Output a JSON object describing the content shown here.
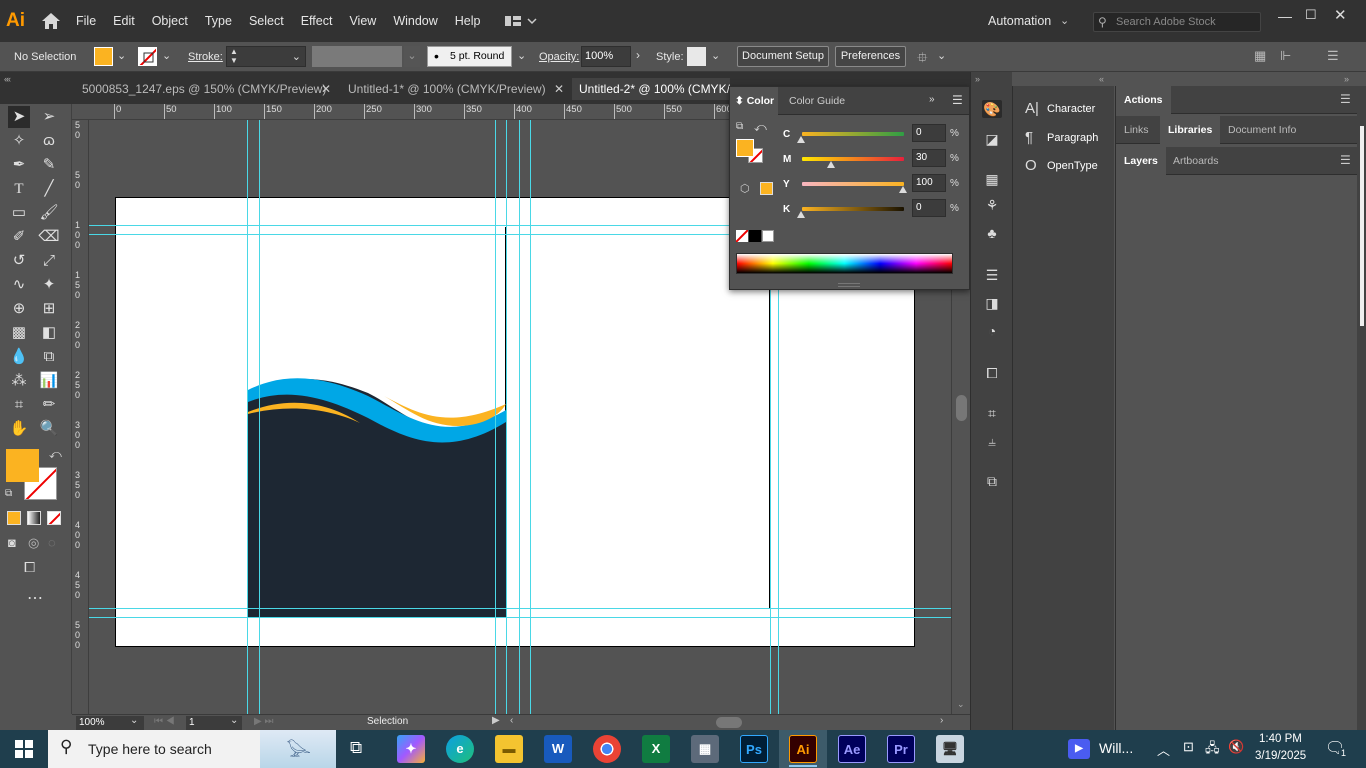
{
  "app": {
    "logo": "Ai"
  },
  "menu": [
    "File",
    "Edit",
    "Object",
    "Type",
    "Select",
    "Effect",
    "View",
    "Window",
    "Help"
  ],
  "workspace": {
    "label": "Automation",
    "search_placeholder": "Search Adobe Stock"
  },
  "control_bar": {
    "selection": "No Selection",
    "stroke_label": "Stroke:",
    "brush": "5 pt. Round",
    "opacity_label": "Opacity:",
    "opacity_value": "100%",
    "style_label": "Style:",
    "document_setup": "Document Setup",
    "preferences": "Preferences"
  },
  "tabs": [
    {
      "label": "5000853_1247.eps @ 150% (CMYK/Preview)",
      "active": false
    },
    {
      "label": "Untitled-1* @ 100% (CMYK/Preview)",
      "active": false
    },
    {
      "label": "Untitled-2* @ 100% (CMYK/P",
      "active": true
    }
  ],
  "ruler_top": [
    "0",
    "50",
    "100",
    "150",
    "200",
    "250",
    "300",
    "350",
    "400",
    "450",
    "500",
    "550",
    "600"
  ],
  "ruler_left": [
    "5\n0",
    "5\n0",
    "1\n0\n0",
    "1\n5\n0",
    "2\n0\n0",
    "2\n5\n0",
    "3\n0\n0",
    "3\n5\n0",
    "4\n0\n0",
    "4\n5\n0",
    "5\n0\n0"
  ],
  "color_panel": {
    "tab_color": "Color",
    "tab_guide": "Color Guide",
    "channels": [
      {
        "label": "C",
        "value": "0",
        "pct": "%",
        "level": 0
      },
      {
        "label": "M",
        "value": "30",
        "pct": "%",
        "level": 30
      },
      {
        "label": "Y",
        "value": "100",
        "pct": "%",
        "level": 100
      },
      {
        "label": "K",
        "value": "0",
        "pct": "%",
        "level": 0
      }
    ]
  },
  "type_panel": {
    "items": [
      "Character",
      "Paragraph",
      "OpenType"
    ]
  },
  "right_panel": {
    "actions": "Actions",
    "tabs1": [
      "Links",
      "Libraries",
      "Document Info"
    ],
    "tabs1_active": "Libraries",
    "tabs2": [
      "Layers",
      "Artboards"
    ]
  },
  "status": {
    "zoom": "100%",
    "page": "1",
    "tool": "Selection"
  },
  "taskbar": {
    "search_placeholder": "Type here to search",
    "zoom_app": "Will...",
    "time": "1:40 PM",
    "date": "3/19/2025",
    "notif": "1"
  },
  "colors": {
    "fill": "#fbb321",
    "navy": "#1d2733",
    "cyan": "#00a7e6",
    "guide": "#4ad8e6"
  }
}
